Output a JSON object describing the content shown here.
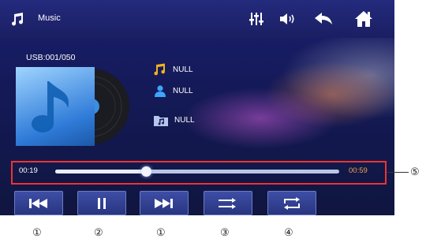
{
  "app": {
    "title": "Music"
  },
  "source": {
    "label": "USB:001/050"
  },
  "track_info": {
    "title": "NULL",
    "artist": "NULL",
    "album": "NULL"
  },
  "playback": {
    "elapsed": "00:19",
    "total": "00:59",
    "progress_fraction": 0.32
  },
  "topbar_icons": [
    "music-note-icon",
    "equalizer-icon",
    "volume-icon",
    "back-arrow-icon",
    "home-icon"
  ],
  "controls": [
    "previous-button",
    "pause-button",
    "next-button",
    "shuffle-button",
    "repeat-button"
  ],
  "callouts": {
    "prev": "①",
    "pause": "②",
    "next": "①",
    "shuffle": "③",
    "repeat": "④",
    "progress": "⑤"
  },
  "colors": {
    "screen_bg": "#141a58",
    "button_bg": "#3e4ea6",
    "highlight": "#e33"
  }
}
